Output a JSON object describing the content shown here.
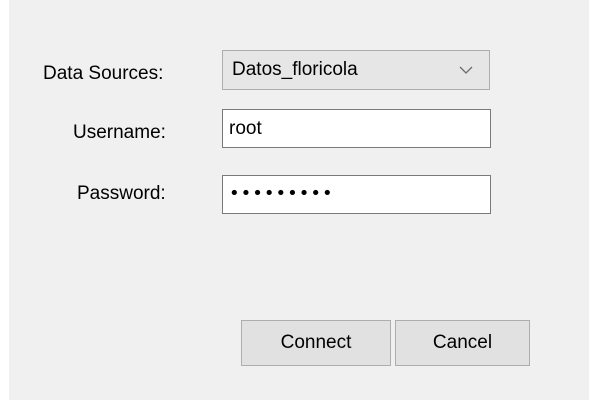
{
  "form": {
    "data_sources_label": "Data Sources:",
    "data_sources_value": "Datos_floricola",
    "username_label": "Username:",
    "username_value": "root",
    "password_label": "Password:",
    "password_masked": "•••••••••"
  },
  "buttons": {
    "connect_label": "Connect",
    "cancel_label": "Cancel"
  },
  "icons": {
    "dropdown": "chevron-down-icon"
  },
  "colors": {
    "dialog_bg": "#f0f0f0",
    "select_bg": "#e6e6e6",
    "button_bg": "#e1e1e1",
    "border": "#adadad",
    "input_border": "#7a7a7a"
  }
}
